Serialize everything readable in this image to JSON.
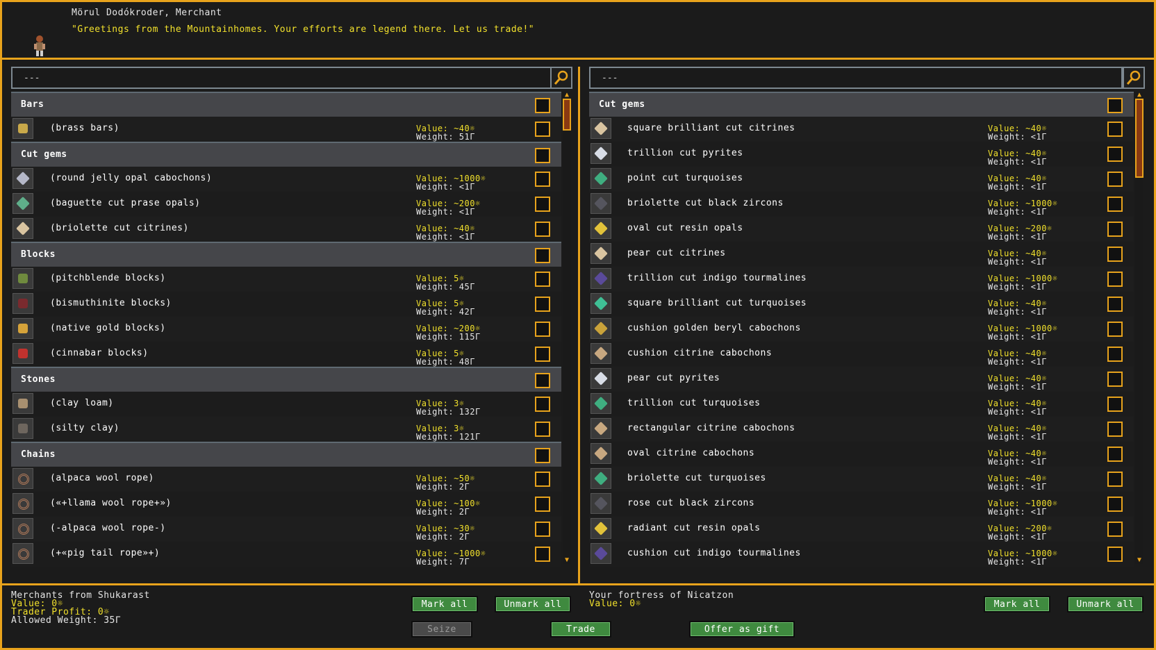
{
  "colors": {
    "frame": "#e8a31c",
    "value_text": "#f2e12c",
    "button_green": "#3f8a3f"
  },
  "header": {
    "merchant_name": "Mörul Dodókroder, Merchant",
    "greeting": "\"Greetings from the Mountainhomes.  Your efforts are legend there.  Let us trade!\""
  },
  "left": {
    "search_value": "---",
    "search_icon": "magnifier-icon",
    "rows": [
      {
        "kind": "cat",
        "label": "Bars"
      },
      {
        "kind": "item",
        "name": "(brass bars)",
        "value": "Value: ~40☼",
        "weight": "Weight: 51Γ",
        "icon": "bar-icon",
        "color": "#c9a94a"
      },
      {
        "kind": "cat",
        "label": "Cut gems"
      },
      {
        "kind": "item",
        "name": "(round jelly opal cabochons)",
        "value": "Value: ~1000☼",
        "weight": "Weight: <1Γ",
        "icon": "gem-icon",
        "color": "#b5b8c8"
      },
      {
        "kind": "item",
        "name": "(baguette cut prase opals)",
        "value": "Value: ~200☼",
        "weight": "Weight: <1Γ",
        "icon": "gem-icon",
        "color": "#5fae8a"
      },
      {
        "kind": "item",
        "name": "(briolette cut citrines)",
        "value": "Value: ~40☼",
        "weight": "Weight: <1Γ",
        "icon": "gem-icon",
        "color": "#d9c4a0"
      },
      {
        "kind": "cat",
        "label": "Blocks"
      },
      {
        "kind": "item",
        "name": "(pitchblende blocks)",
        "value": "Value: 5☼",
        "weight": "Weight: 45Γ",
        "icon": "block-icon",
        "color": "#6f8a3e"
      },
      {
        "kind": "item",
        "name": "(bismuthinite blocks)",
        "value": "Value: 5☼",
        "weight": "Weight: 42Γ",
        "icon": "block-icon",
        "color": "#7a2a2e"
      },
      {
        "kind": "item",
        "name": "(native gold blocks)",
        "value": "Value: ~200☼",
        "weight": "Weight: 115Γ",
        "icon": "block-icon",
        "color": "#d6a33a"
      },
      {
        "kind": "item",
        "name": "(cinnabar blocks)",
        "value": "Value: 5☼",
        "weight": "Weight: 48Γ",
        "icon": "block-icon",
        "color": "#c0322e"
      },
      {
        "kind": "cat",
        "label": "Stones"
      },
      {
        "kind": "item",
        "name": "(clay loam)",
        "value": "Value: 3☼",
        "weight": "Weight: 132Γ",
        "icon": "stone-icon",
        "color": "#a89070"
      },
      {
        "kind": "item",
        "name": "(silty clay)",
        "value": "Value: 3☼",
        "weight": "Weight: 121Γ",
        "icon": "stone-icon",
        "color": "#6e665e"
      },
      {
        "kind": "cat",
        "label": "Chains"
      },
      {
        "kind": "item",
        "name": "(alpaca wool rope)",
        "value": "Value: ~50☼",
        "weight": "Weight: 2Γ",
        "icon": "rope-icon",
        "color": "#b07a5a"
      },
      {
        "kind": "item",
        "name": "(«+llama wool rope+»)",
        "value": "Value: ~100☼",
        "weight": "Weight: 2Γ",
        "icon": "rope-icon",
        "color": "#b07a5a"
      },
      {
        "kind": "item",
        "name": "(-alpaca wool rope-)",
        "value": "Value: ~30☼",
        "weight": "Weight: 2Γ",
        "icon": "rope-icon",
        "color": "#b07a5a"
      },
      {
        "kind": "item",
        "name": "(+«pig tail rope»+)",
        "value": "Value: ~1000☼",
        "weight": "Weight: 7Γ",
        "icon": "rope-icon",
        "color": "#b07a5a"
      }
    ]
  },
  "right": {
    "search_value": "---",
    "search_icon": "magnifier-icon",
    "rows": [
      {
        "kind": "cat",
        "label": "Cut gems"
      },
      {
        "kind": "item",
        "name": "square brilliant cut citrines",
        "value": "Value: ~40☼",
        "weight": "Weight: <1Γ",
        "icon": "gem-icon",
        "color": "#d9c4a0"
      },
      {
        "kind": "item",
        "name": "trillion cut pyrites",
        "value": "Value: ~40☼",
        "weight": "Weight: <1Γ",
        "icon": "gem-icon",
        "color": "#d8dde6"
      },
      {
        "kind": "item",
        "name": "point cut turquoises",
        "value": "Value: ~40☼",
        "weight": "Weight: <1Γ",
        "icon": "gem-icon",
        "color": "#3fae80"
      },
      {
        "kind": "item",
        "name": "briolette cut black zircons",
        "value": "Value: ~1000☼",
        "weight": "Weight: <1Γ",
        "icon": "gem-icon",
        "color": "#55555e"
      },
      {
        "kind": "item",
        "name": "oval cut resin opals",
        "value": "Value: ~200☼",
        "weight": "Weight: <1Γ",
        "icon": "gem-icon",
        "color": "#e2c23a"
      },
      {
        "kind": "item",
        "name": "pear cut citrines",
        "value": "Value: ~40☼",
        "weight": "Weight: <1Γ",
        "icon": "gem-icon",
        "color": "#d9c4a0"
      },
      {
        "kind": "item",
        "name": "trillion cut indigo tourmalines",
        "value": "Value: ~1000☼",
        "weight": "Weight: <1Γ",
        "icon": "gem-icon",
        "color": "#5a4a9a"
      },
      {
        "kind": "item",
        "name": "square brilliant cut turquoises",
        "value": "Value: ~40☼",
        "weight": "Weight: <1Γ",
        "icon": "gem-icon",
        "color": "#3fbf95"
      },
      {
        "kind": "item",
        "name": "cushion golden beryl cabochons",
        "value": "Value: ~1000☼",
        "weight": "Weight: <1Γ",
        "icon": "gem-icon",
        "color": "#c9a23a"
      },
      {
        "kind": "item",
        "name": "cushion citrine cabochons",
        "value": "Value: ~40☼",
        "weight": "Weight: <1Γ",
        "icon": "gem-icon",
        "color": "#c8a880"
      },
      {
        "kind": "item",
        "name": "pear cut pyrites",
        "value": "Value: ~40☼",
        "weight": "Weight: <1Γ",
        "icon": "gem-icon",
        "color": "#d8dde6"
      },
      {
        "kind": "item",
        "name": "trillion cut turquoises",
        "value": "Value: ~40☼",
        "weight": "Weight: <1Γ",
        "icon": "gem-icon",
        "color": "#3fae80"
      },
      {
        "kind": "item",
        "name": "rectangular citrine cabochons",
        "value": "Value: ~40☼",
        "weight": "Weight: <1Γ",
        "icon": "gem-icon",
        "color": "#c8a880"
      },
      {
        "kind": "item",
        "name": "oval citrine cabochons",
        "value": "Value: ~40☼",
        "weight": "Weight: <1Γ",
        "icon": "gem-icon",
        "color": "#c8a880"
      },
      {
        "kind": "item",
        "name": "briolette cut turquoises",
        "value": "Value: ~40☼",
        "weight": "Weight: <1Γ",
        "icon": "gem-icon",
        "color": "#3fae80"
      },
      {
        "kind": "item",
        "name": "rose cut black zircons",
        "value": "Value: ~1000☼",
        "weight": "Weight: <1Γ",
        "icon": "gem-icon",
        "color": "#55555e"
      },
      {
        "kind": "item",
        "name": "radiant cut resin opals",
        "value": "Value: ~200☼",
        "weight": "Weight: <1Γ",
        "icon": "gem-icon",
        "color": "#e2c23a"
      },
      {
        "kind": "item",
        "name": "cushion cut indigo tourmalines",
        "value": "Value: ~1000☼",
        "weight": "Weight: <1Γ",
        "icon": "gem-icon",
        "color": "#5a4a9a"
      }
    ]
  },
  "footer": {
    "left": {
      "title": "Merchants from Shukarast",
      "value": "Value: 0☼",
      "profit": "Trader Profit: 0☼",
      "allowed_weight": "Allowed Weight: 35Γ"
    },
    "right": {
      "title": "Your fortress of Nicatzon",
      "value": "Value: 0☼"
    },
    "buttons": {
      "mark_all": "Mark all",
      "unmark_all": "Unmark all",
      "seize": "Seize",
      "trade": "Trade",
      "offer_gift": "Offer as gift"
    }
  }
}
